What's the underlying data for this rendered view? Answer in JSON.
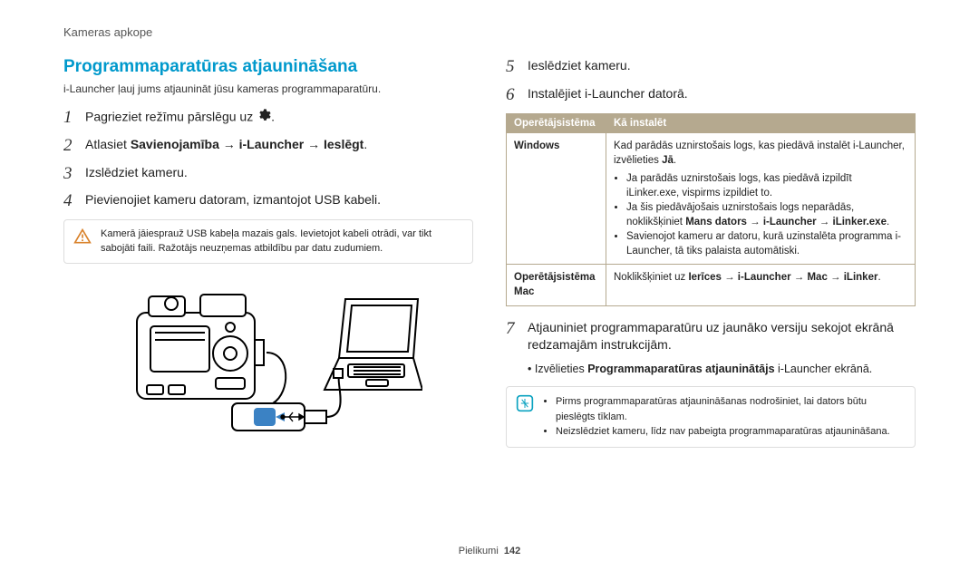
{
  "header": {
    "breadcrumb": "Kameras apkope"
  },
  "section": {
    "title": "Programmaparatūras atjaunināšana",
    "intro": "i-Launcher ļauj jums atjaunināt jūsu kameras programmaparatūru."
  },
  "steps_left": [
    {
      "n": "1",
      "text_pre": "Pagrieziet režīmu pārslēgu uz ",
      "text_post": "."
    },
    {
      "n": "2",
      "text_pre": "Atlasiet ",
      "bold": "Savienojamība → i-Launcher → Ieslēgt",
      "text_post": "."
    },
    {
      "n": "3",
      "text": "Izslēdziet kameru."
    },
    {
      "n": "4",
      "text": "Pievienojiet kameru datoram, izmantojot USB kabeli."
    }
  ],
  "warning": {
    "text": "Kamerā jāiesprauž USB kabeļa mazais gals. Ievietojot kabeli otrādi, var tikt sabojāti faili. Ražotājs neuzņemas atbildību par datu zudumiem."
  },
  "steps_right_56": [
    {
      "n": "5",
      "text": "Ieslēdziet kameru."
    },
    {
      "n": "6",
      "text": "Instalējiet i-Launcher datorā."
    }
  ],
  "table": {
    "h1": "Operētājsistēma",
    "h2": "Kā instalēt",
    "rows": [
      {
        "os": "Windows",
        "line1_pre": "Kad parādās uznirstošais logs, kas piedāvā instalēt i-Launcher, izvēlieties ",
        "line1_bold": "Jā",
        "line1_post": ".",
        "b1": "Ja parādās uznirstošais logs, kas piedāvā izpildīt iLinker.exe, vispirms izpildiet to.",
        "b2_pre": "Ja šis piedāvājošais uznirstošais logs neparādās, noklikšķiniet ",
        "b2_bold": "Mans dators → i-Launcher → iLinker.exe",
        "b2_post": ".",
        "b3": "Savienojot kameru ar datoru, kurā uzinstalēta programma i-Launcher, tā tiks palaista automātiski."
      },
      {
        "os": "Operētājsistēma Mac",
        "line_pre": "Noklikšķiniet uz ",
        "line_bold": "Ierīces → i-Launcher → Mac → iLinker",
        "line_post": "."
      }
    ]
  },
  "step7": {
    "n": "7",
    "text": "Atjauniniet programmaparatūru uz jaunāko versiju sekojot ekrānā redzamajām instrukcijām.",
    "sub_pre": "• Izvēlieties ",
    "sub_bold": "Programmaparatūras atjauninātājs",
    "sub_post": " i-Launcher ekrānā."
  },
  "info": {
    "b1": "Pirms programmaparatūras atjaunināšanas nodrošiniet, lai dators būtu pieslēgts tīklam.",
    "b2": "Neizslēdziet kameru, līdz nav pabeigta programmaparatūras atjaunināšana."
  },
  "footer": {
    "label": "Pielikumi",
    "page": "142"
  }
}
